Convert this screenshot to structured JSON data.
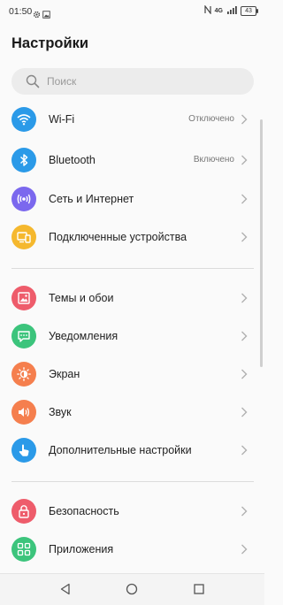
{
  "status_bar": {
    "time": "01:50",
    "battery": "43",
    "network": "4G",
    "icons": [
      "gear-icon",
      "image-icon",
      "nfc-icon",
      "signal-icon",
      "battery-icon"
    ]
  },
  "page": {
    "title": "Настройки"
  },
  "search": {
    "placeholder": "Поиск"
  },
  "groups": [
    {
      "items": [
        {
          "label": "Wi-Fi",
          "value": "Отключено",
          "icon": "wifi-icon",
          "color": "#2b9ae8"
        },
        {
          "label": "Bluetooth",
          "value": "Включено",
          "icon": "bluetooth-icon",
          "color": "#2b9ae8"
        },
        {
          "label": "Сеть и Интернет",
          "value": "",
          "icon": "network-icon",
          "color": "#7b68ee"
        },
        {
          "label": "Подключенные устройства",
          "value": "",
          "icon": "devices-icon",
          "color": "#f5b82e"
        }
      ]
    },
    {
      "items": [
        {
          "label": "Темы и обои",
          "value": "",
          "icon": "wallpaper-icon",
          "color": "#ee5c6b"
        },
        {
          "label": "Уведомления",
          "value": "",
          "icon": "notification-icon",
          "color": "#3cc47c"
        },
        {
          "label": "Экран",
          "value": "",
          "icon": "brightness-icon",
          "color": "#f57f4e"
        },
        {
          "label": "Звук",
          "value": "",
          "icon": "sound-icon",
          "color": "#f57f4e"
        },
        {
          "label": "Дополнительные настройки",
          "value": "",
          "icon": "hand-icon",
          "color": "#2b9ae8"
        }
      ]
    },
    {
      "items": [
        {
          "label": "Безопасность",
          "value": "",
          "icon": "lock-icon",
          "color": "#ee5c6b"
        },
        {
          "label": "Приложения",
          "value": "",
          "icon": "apps-icon",
          "color": "#3cc47c"
        }
      ]
    }
  ],
  "nav": [
    "back-icon",
    "home-icon",
    "recents-icon"
  ]
}
